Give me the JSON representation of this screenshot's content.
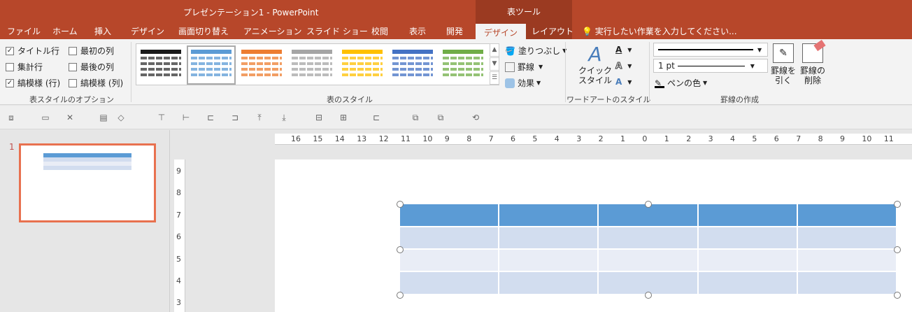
{
  "window": {
    "title": "プレゼンテーション1 - PowerPoint",
    "context_title": "表ツール"
  },
  "tabs": [
    "ファイル",
    "ホーム",
    "挿入",
    "デザイン",
    "画面切り替え",
    "アニメーション",
    "スライド ショー",
    "校閲",
    "表示",
    "開発",
    "デザイン",
    "レイアウト"
  ],
  "tell_me": "実行したい作業を入力してください...",
  "style_options": {
    "items": [
      {
        "label": "タイトル行",
        "checked": "✓"
      },
      {
        "label": "集計行",
        "checked": ""
      },
      {
        "label": "縞模様 (行)",
        "checked": "✓"
      },
      {
        "label": "最初の列",
        "checked": ""
      },
      {
        "label": "最後の列",
        "checked": ""
      },
      {
        "label": "縞模様 (列)",
        "checked": ""
      }
    ],
    "group_label": "表スタイルのオプション"
  },
  "table_styles": {
    "group_label": "表のスタイル",
    "swatches": [
      "#1a1a1a",
      "#5b9bd5",
      "#ed7d31",
      "#a5a5a5",
      "#ffc000",
      "#4472c4",
      "#70ad47"
    ],
    "shading": "塗りつぶし",
    "borders": "罫線",
    "effects": "効果"
  },
  "wordart": {
    "quick_styles_line1": "クイック",
    "quick_styles_line2": "スタイル",
    "group_label": "ワードアートのスタイル"
  },
  "draw_borders": {
    "weight": "1 pt",
    "pen_color": "ペンの色",
    "draw_line1": "罫線を",
    "draw_line2": "引く",
    "erase_line1": "罫線の",
    "erase_line2": "削除",
    "group_label": "罫線の作成"
  },
  "thumbnail": {
    "number": "1"
  },
  "ruler": {
    "h_labels": [
      "16",
      "15",
      "14",
      "13",
      "12",
      "11",
      "10",
      "9",
      "8",
      "7",
      "6",
      "5",
      "4",
      "3",
      "2",
      "1",
      "0",
      "1",
      "2",
      "3",
      "4",
      "5",
      "6",
      "7",
      "8",
      "9",
      "10",
      "11"
    ],
    "v_labels": [
      "9",
      "8",
      "7",
      "6",
      "5",
      "4",
      "3"
    ]
  },
  "colors": {
    "accent": "#b7472a",
    "header": "#5b9bd5",
    "band1": "#d2ddef",
    "band2": "#e9edf6"
  }
}
